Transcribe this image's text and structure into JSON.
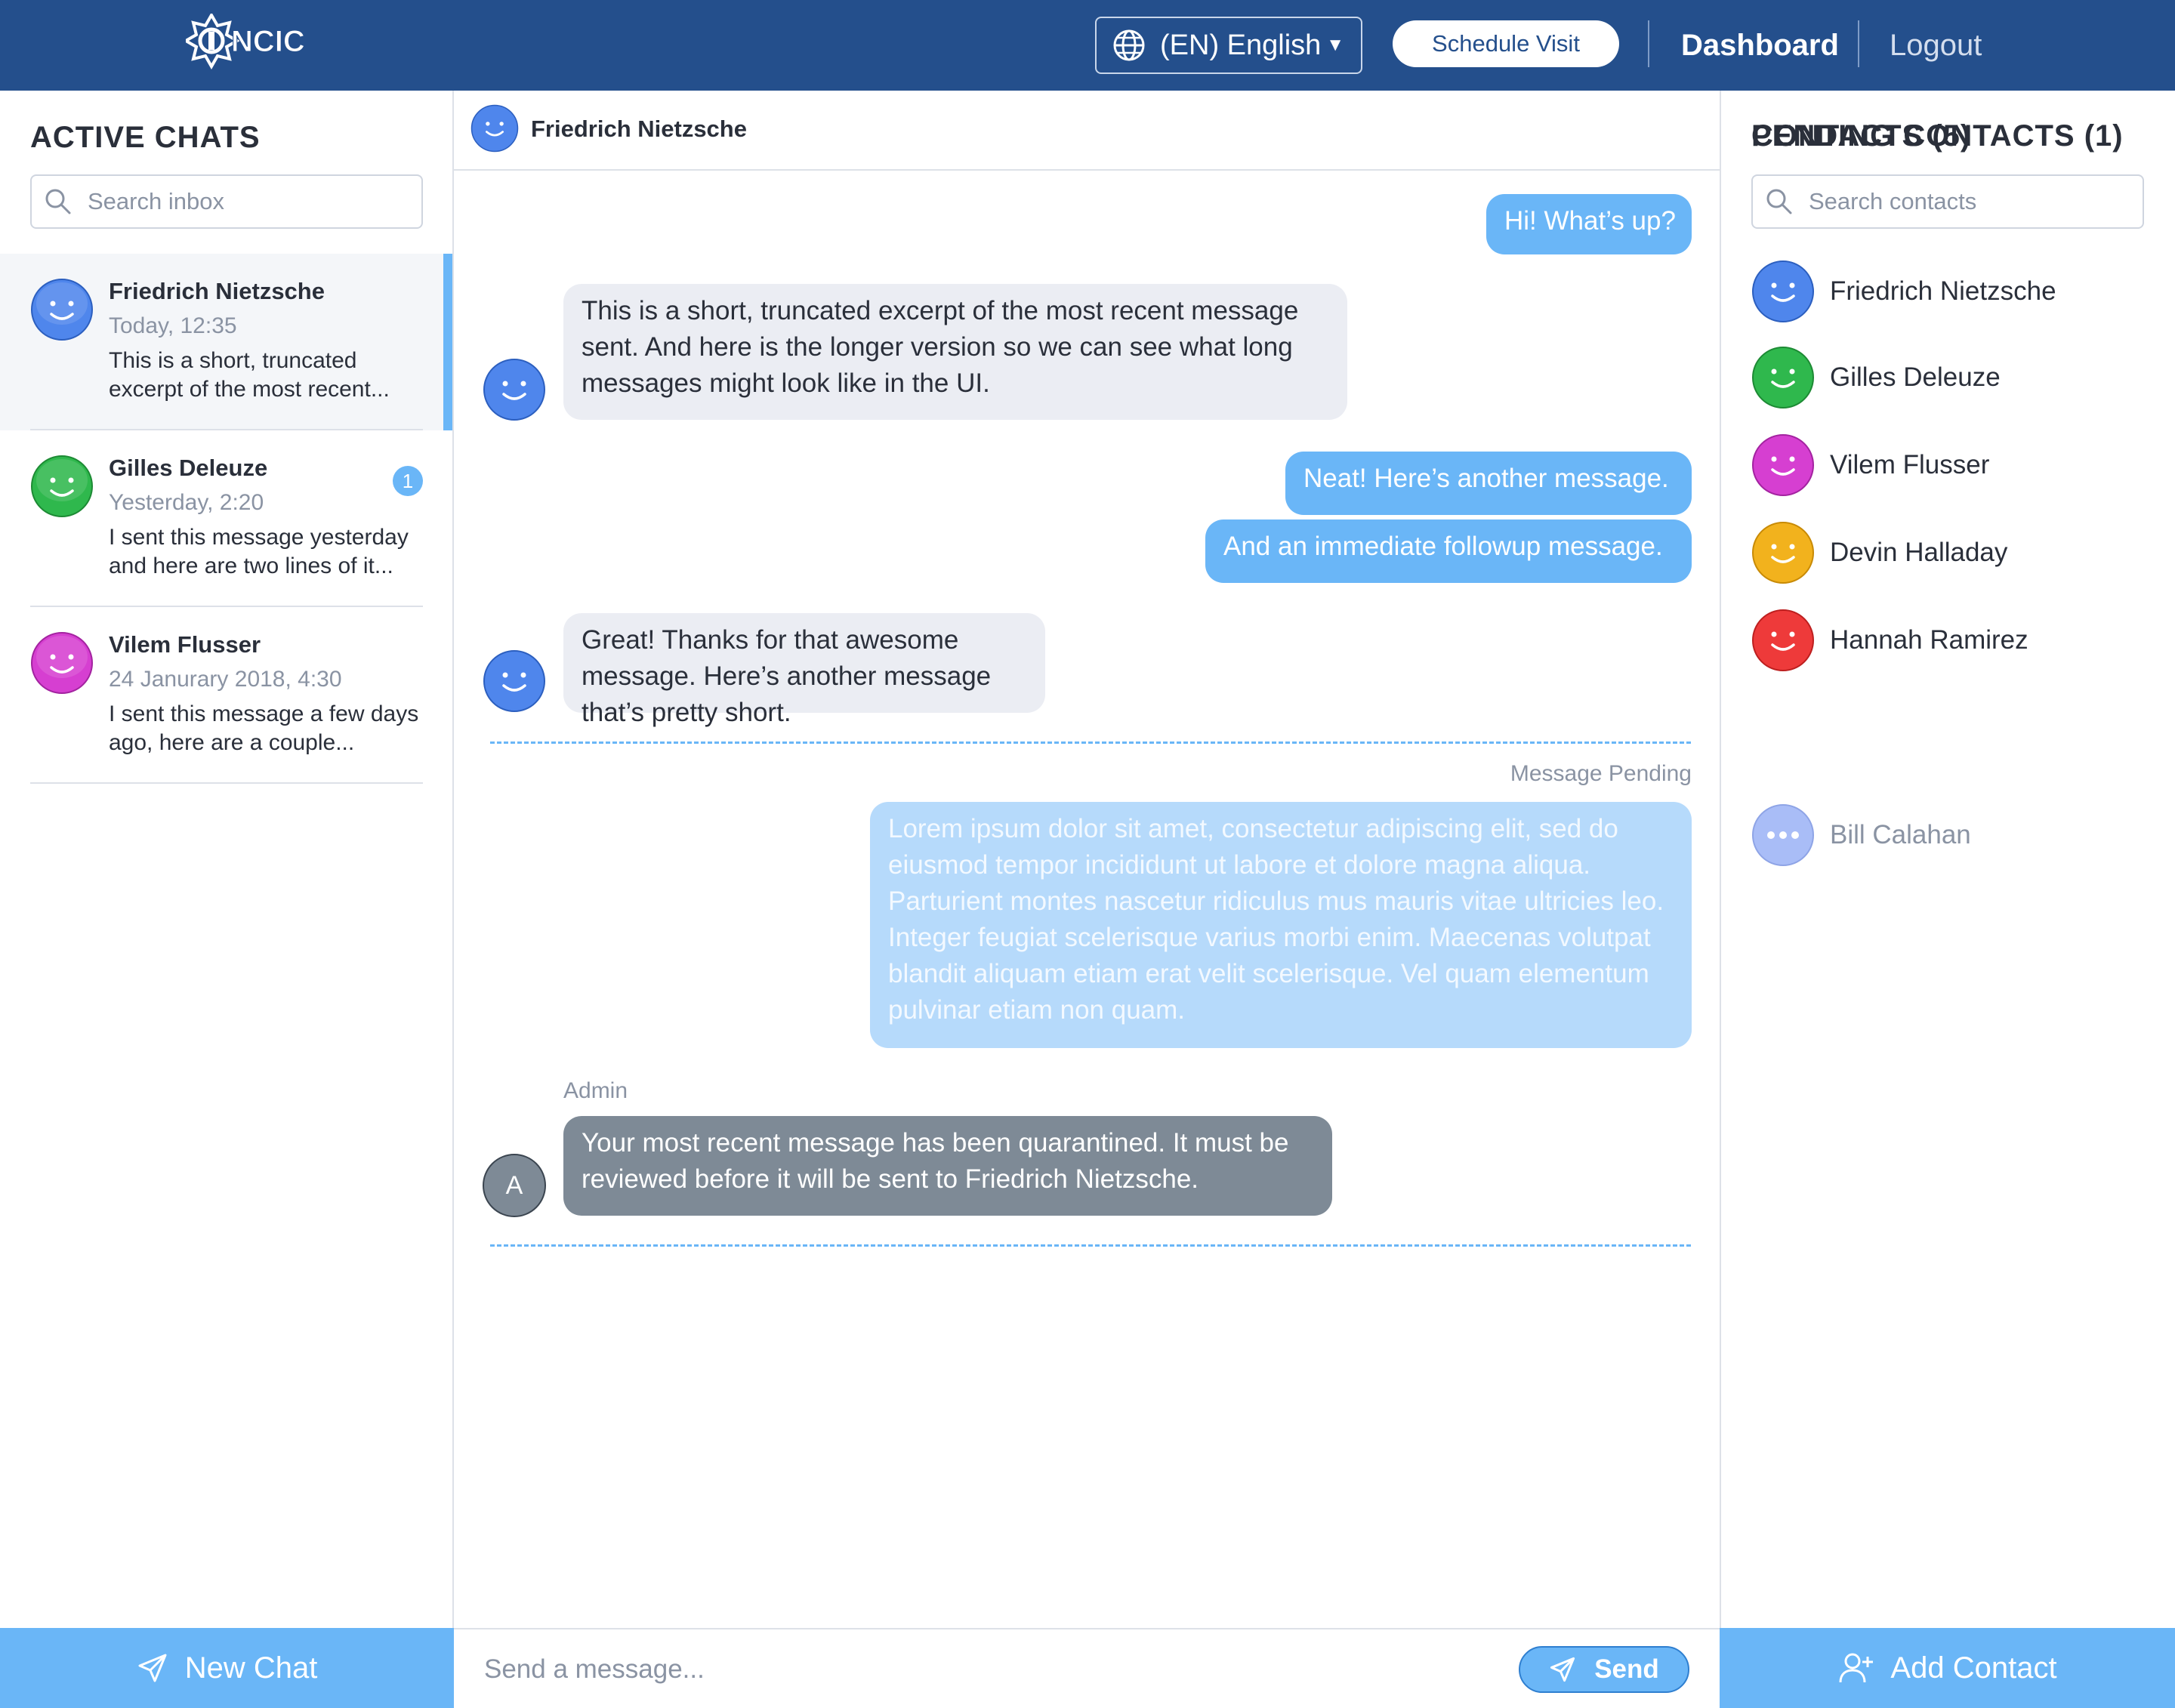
{
  "header": {
    "logo_text": "NCIC",
    "language": "(EN) English",
    "schedule_label": "Schedule Visit",
    "dashboard_label": "Dashboard",
    "logout_label": "Logout",
    "bar_color": "#244f8c"
  },
  "left": {
    "title": "ACTIVE CHATS",
    "search_placeholder": "Search inbox",
    "chats": [
      {
        "name": "Friedrich Nietzsche",
        "time": "Today, 12:35",
        "preview": "This is a short, truncated excerpt of the most recent...",
        "color": "#4f86ec",
        "active": true
      },
      {
        "name": "Gilles Deleuze",
        "time": "Yesterday, 2:20",
        "preview": "I sent this message yesterday and here are two lines of it...",
        "color": "#2fb84d",
        "unread": "1"
      },
      {
        "name": "Vilem Flusser",
        "time": "24 Janurary 2018, 4:30",
        "preview": "I sent this message a few days ago, here are a couple...",
        "color": "#d63fd1"
      }
    ],
    "new_chat_label": "New Chat"
  },
  "chat": {
    "contact_name": "Friedrich Nietzsche",
    "messages": {
      "m1": "Hi! What’s up?",
      "m2": "This is a short, truncated excerpt of the most recent message sent. And here is the longer version so we can see what long messages might look like in the UI.",
      "m3": "Neat! Here’s another message.",
      "m4": "And an immediate followup message.",
      "m5": "Great! Thanks for that awesome message. Here’s another message that’s pretty short.",
      "pending_label": "Message Pending",
      "m6": "Lorem ipsum dolor sit amet, consectetur adipiscing elit, sed do eiusmod tempor incididunt ut labore et dolore magna aliqua. Parturient montes nascetur ridiculus mus mauris vitae ultricies leo. Integer feugiat scelerisque varius morbi enim. Maecenas volutpat blandit aliquam etiam erat velit scelerisque. Vel quam elementum pulvinar etiam non quam.",
      "admin_label": "Admin",
      "admin_initial": "A",
      "m7": "Your most recent message has been quarantined. It must be reviewed before it will be sent to Friedrich Nietzsche."
    },
    "composer_placeholder": "Send a message...",
    "send_label": "Send"
  },
  "right": {
    "title": "CONTACTS (5)",
    "search_placeholder": "Search contacts",
    "contacts": [
      {
        "name": "Friedrich Nietzsche",
        "color": "#4f86ec"
      },
      {
        "name": "Gilles Deleuze",
        "color": "#2fb84d"
      },
      {
        "name": "Vilem Flusser",
        "color": "#d63fd1"
      },
      {
        "name": "Devin Halladay",
        "color": "#f2b21d"
      },
      {
        "name": "Hannah Ramirez",
        "color": "#ee3a3a"
      }
    ],
    "pending_title": "PENDING CONTACTS (1)",
    "pending": [
      {
        "name": "Bill Calahan",
        "color": "#a9bdf7"
      }
    ],
    "add_contact_label": "Add Contact"
  },
  "colors": {
    "accent": "#6ab6f7",
    "incoming_bubble": "#ebedf3",
    "pending_bubble": "#b6dafb",
    "admin_bubble": "#7e8a96"
  }
}
